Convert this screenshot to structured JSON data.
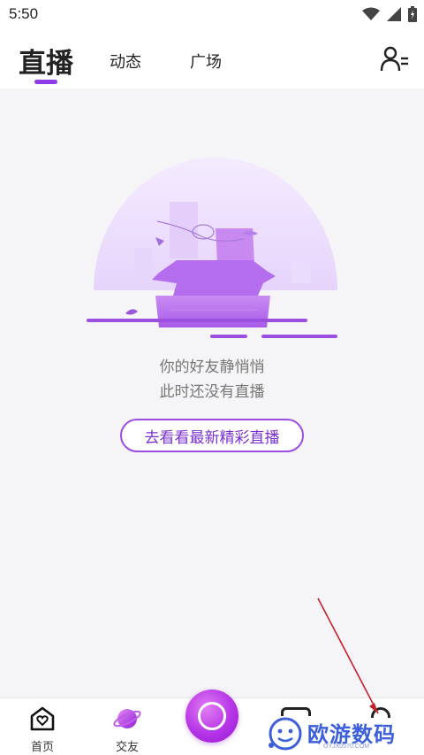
{
  "status_bar": {
    "time": "5:50"
  },
  "top_nav": {
    "tabs": [
      {
        "label": "直播",
        "active": true
      },
      {
        "label": "动态",
        "active": false
      },
      {
        "label": "广场",
        "active": false
      }
    ],
    "accent": "#8e3ae6"
  },
  "empty_state": {
    "line1": "你的好友静悄悄",
    "line2": "此时还没有直播",
    "cta": "去看看最新精彩直播"
  },
  "bottom_nav": {
    "items": [
      {
        "label": "首页",
        "icon": "home-heart-icon"
      },
      {
        "label": "交友",
        "icon": "planet-icon"
      },
      {
        "label": "",
        "icon": "live-camera-icon"
      },
      {
        "label": "",
        "icon": "message-icon"
      },
      {
        "label": "",
        "icon": "profile-icon"
      }
    ]
  },
  "watermark": {
    "brand": "欧游数码",
    "url": "OYJX0570.COM"
  }
}
